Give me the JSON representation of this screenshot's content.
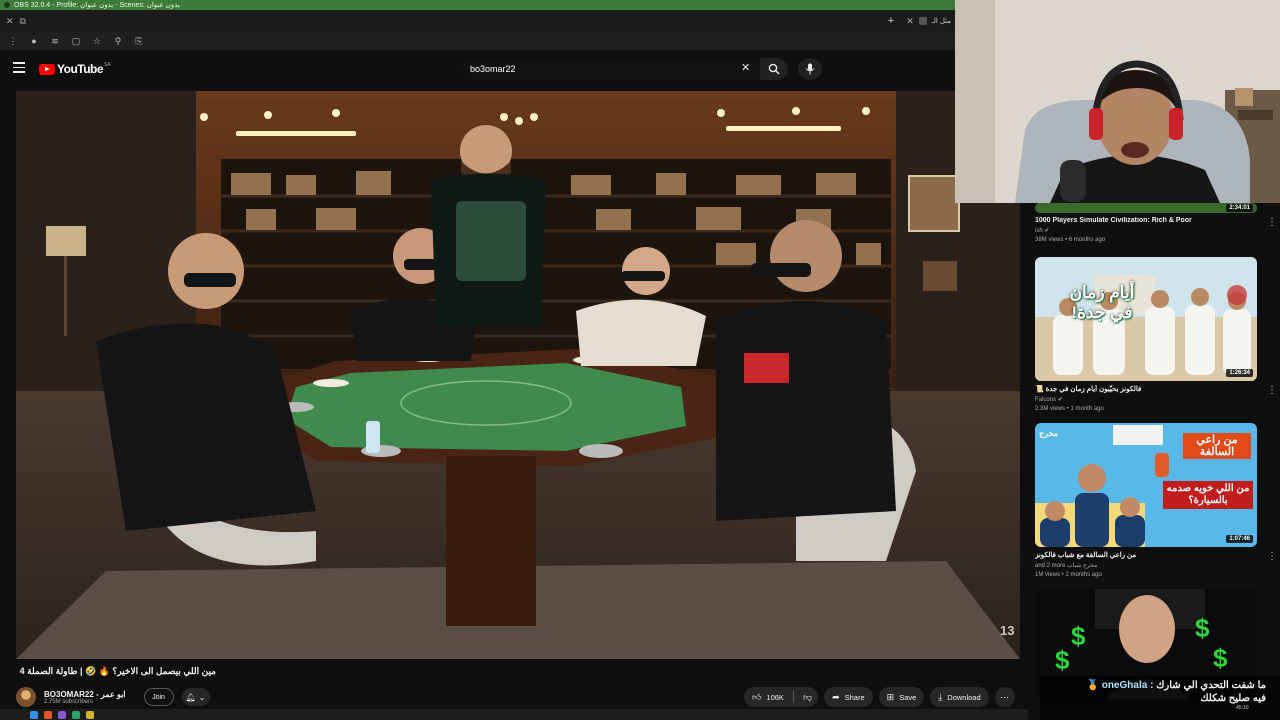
{
  "obs": {
    "title": "OBS 32.0.4 - Profile: بدون عنوان - Scenes: بدون عنوان"
  },
  "browser": {
    "tab_close": "✕",
    "new_tab": "+",
    "tab_short": "مثل الـ"
  },
  "header": {
    "logo_text": "YouTube",
    "country_code": "SA",
    "search_value": "bo3omar22"
  },
  "video": {
    "title": "مين اللي بيصمل الى الاخير؟ 🔥 🤣 | طاولة الصملة 4",
    "watermark": "13"
  },
  "channel": {
    "name": "BO3OMAR22 - ابو عمر",
    "subscribers": "2.75M subscribers",
    "join_label": "Join"
  },
  "actions": {
    "like_count": "106K",
    "share_label": "Share",
    "save_label": "Save",
    "download_label": "Download"
  },
  "sidebar": {
    "items": [
      {
        "title": "1000 Players Simulate Civilization: Rich & Poor",
        "channel": "ish",
        "meta": "38M views • 6 months ago",
        "duration": "2:34:01",
        "thumb_text": ""
      },
      {
        "title": "فالكونز يحيّيون أيام زمان في جدة 📜",
        "channel": "Falcons",
        "meta": "2.3M views • 1 month ago",
        "duration": "1:26:34",
        "thumb_text": "أيام زمان في جدة!"
      },
      {
        "title": "من راعي السالفة مع شباب فالكونز",
        "channel": "and 2 more مخرج شباب",
        "meta": "1M views • 2 months ago",
        "duration": "1:07:46",
        "thumb_text": "من راعي السالفة",
        "thumb_text2": "من اللي خويه صدمه بالسيارة؟",
        "thumb_badge": "مخرج"
      },
      {
        "title": "",
        "channel": "",
        "meta": "",
        "duration": "",
        "thumb_text": ""
      }
    ]
  },
  "chat": {
    "user": "oneGhala",
    "line1": "ما شفت التحدي الي شارك",
    "line2": "فيه صليح شكلك",
    "time": "45:10"
  },
  "colors": {
    "obs_green": "#3e7b3a",
    "yt_red": "#ff0000",
    "table_green": "#3f8a4c"
  }
}
